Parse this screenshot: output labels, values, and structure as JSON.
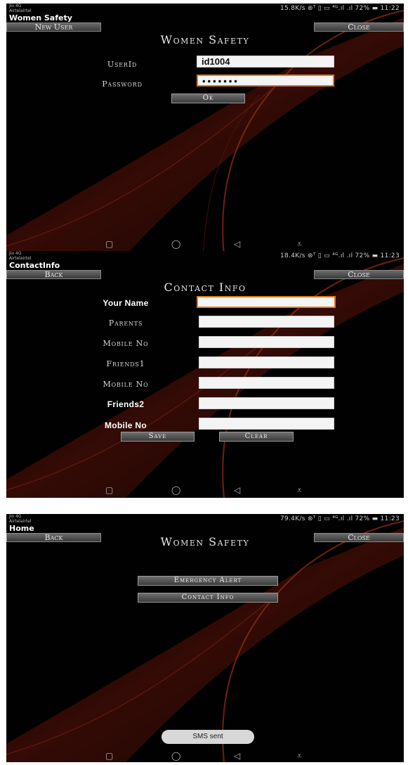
{
  "status_bar": {
    "carrier_line1": "Jio 4G",
    "carrier_line2": "Airtelairtel",
    "screen1_right": "15.8K/s ⊛ᵀ ▯ ▭ ⁴ᴳ.ıl .ıl 72% ▬ 11:22",
    "screen2_right": "18.4K/s ⊛ᵀ ▯ ▭ ⁴ᴳ.ıl .ıl 72% ▬ 11:23",
    "screen3_right": "79.4K/s ⊛ᵀ ▯ ▭ ⁴ᴳ.ıl .ıl 72% ▬ 11:23"
  },
  "screen_login": {
    "app_title": "Women Safety",
    "new_user_button": "New User",
    "close_button": "Close",
    "heading": "Women Safety",
    "userid_label": "UserId",
    "userid_value": "id1004",
    "password_label": "Password",
    "password_value": "•••••••",
    "ok_button": "Ok"
  },
  "screen_contact": {
    "app_title": "ContactInfo",
    "back_button": "Back",
    "close_button": "Close",
    "heading": "Contact Info",
    "your_name_label": "Your Name",
    "parents_label": "Parents",
    "mobile_no_label_1": "Mobile No",
    "friends1_label": "Friends1",
    "mobile_no_label_2": "Mobile No",
    "friends2_label": "Friends2",
    "mobile_no_label_3": "Mobile No",
    "save_button": "Save",
    "clear_button": "Clear"
  },
  "screen_home": {
    "app_title": "Home",
    "back_button": "Back",
    "close_button": "Close",
    "heading": "Women Safety",
    "emergency_alert_button": "Emergency Alert",
    "contact_info_button": "Contact Info",
    "toast": "SMS sent"
  },
  "nav_icons": [
    "square-icon",
    "circle-icon",
    "triangle-back-icon",
    "notification-down-icon"
  ],
  "colors": {
    "background": "#000000",
    "swirl": "#7a1e12",
    "focus_border": "#e07a1f",
    "appbar_text": "#ffffff"
  }
}
